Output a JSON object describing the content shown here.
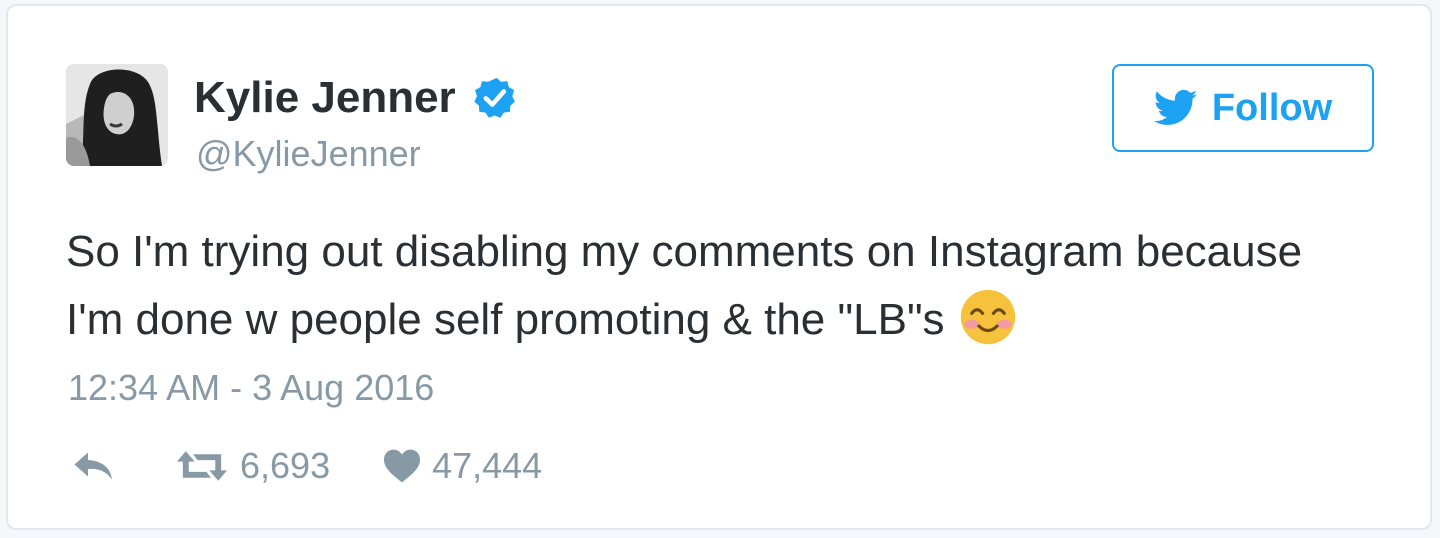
{
  "tweet": {
    "author": {
      "name": "Kylie Jenner",
      "handle": "@KylieJenner",
      "verified": true,
      "avatar_icon": "profile-photo"
    },
    "follow_button": {
      "label": "Follow",
      "icon": "twitter-bird-icon"
    },
    "text_lines": [
      "So I'm trying out disabling my comments on Instagram because",
      "I'm done w people self promoting & the \"LB\"s"
    ],
    "emoji": "smiling-face-with-smiling-eyes",
    "timestamp": "12:34 AM - 3 Aug 2016",
    "actions": {
      "reply_icon": "reply-icon",
      "retweet_icon": "retweet-icon",
      "retweet_count": "6,693",
      "like_icon": "heart-icon",
      "like_count": "47,444"
    }
  },
  "colors": {
    "accent": "#1da1f2",
    "text": "#292f33",
    "muted": "#8899a6",
    "border": "#e1e8ed",
    "emoji": "#f7c23b"
  }
}
